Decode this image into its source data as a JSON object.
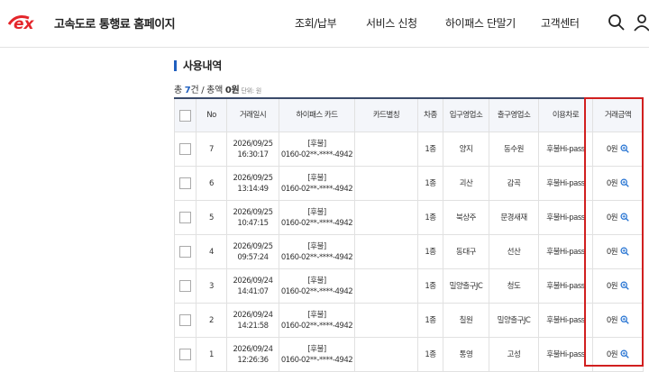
{
  "brand": {
    "logo_text": "ex",
    "title": "고속도로 통행료 홈페이지",
    "accent_color": "#e4262b"
  },
  "nav": [
    "조회/납부",
    "서비스 신청",
    "하이패스 단말기",
    "고객센터"
  ],
  "header_icons": [
    "search-icon",
    "user-icon"
  ],
  "section_title": "사용내역",
  "summary": {
    "total_prefix": "총 ",
    "count": "7",
    "count_unit": "건",
    "sep": " / 총액 ",
    "amount": "0",
    "amount_unit": "원",
    "unit_note": "단위: 원"
  },
  "columns": [
    "",
    "No",
    "거래일시",
    "하이패스 카드",
    "카드별칭",
    "차종",
    "입구영업소",
    "출구영업소",
    "이용차로",
    "거래금액"
  ],
  "rows": [
    {
      "no": "7",
      "date": "2026/09/25",
      "time": "16:30:17",
      "card_type": "[후불]",
      "card_no": "0160-02**-****-4942",
      "alias": "",
      "vehicle": "1종",
      "entry": "양지",
      "exit": "동수원",
      "lane": "후불Hi-pass",
      "amount": "0원"
    },
    {
      "no": "6",
      "date": "2026/09/25",
      "time": "13:14:49",
      "card_type": "[후불]",
      "card_no": "0160-02**-****-4942",
      "alias": "",
      "vehicle": "1종",
      "entry": "괴산",
      "exit": "감곡",
      "lane": "후불Hi-pass",
      "amount": "0원"
    },
    {
      "no": "5",
      "date": "2026/09/25",
      "time": "10:47:15",
      "card_type": "[후불]",
      "card_no": "0160-02**-****-4942",
      "alias": "",
      "vehicle": "1종",
      "entry": "북상주",
      "exit": "문경새재",
      "lane": "후불Hi-pass",
      "amount": "0원"
    },
    {
      "no": "4",
      "date": "2026/09/25",
      "time": "09:57:24",
      "card_type": "[후불]",
      "card_no": "0160-02**-****-4942",
      "alias": "",
      "vehicle": "1종",
      "entry": "동대구",
      "exit": "선산",
      "lane": "후불Hi-pass",
      "amount": "0원"
    },
    {
      "no": "3",
      "date": "2026/09/24",
      "time": "14:41:07",
      "card_type": "[후불]",
      "card_no": "0160-02**-****-4942",
      "alias": "",
      "vehicle": "1종",
      "entry": "밀양출구JC",
      "exit": "청도",
      "lane": "후불Hi-pass",
      "amount": "0원"
    },
    {
      "no": "2",
      "date": "2026/09/24",
      "time": "14:21:58",
      "card_type": "[후불]",
      "card_no": "0160-02**-****-4942",
      "alias": "",
      "vehicle": "1종",
      "entry": "칠원",
      "exit": "밀양출구JC",
      "lane": "후불Hi-pass",
      "amount": "0원"
    },
    {
      "no": "1",
      "date": "2026/09/24",
      "time": "12:26:36",
      "card_type": "[후불]",
      "card_no": "0160-02**-****-4942",
      "alias": "",
      "vehicle": "1종",
      "entry": "통영",
      "exit": "고성",
      "lane": "후불Hi-pass",
      "amount": "0원"
    }
  ],
  "highlight_color": "#d11f1f"
}
